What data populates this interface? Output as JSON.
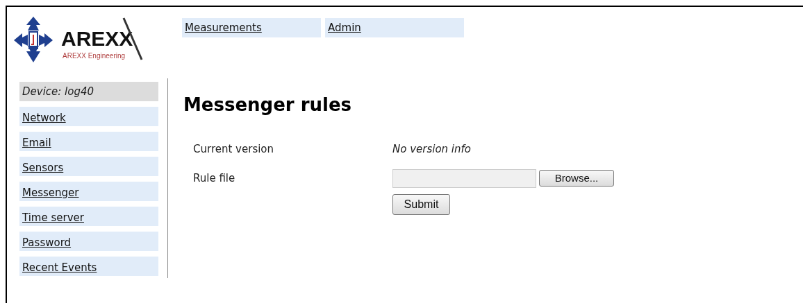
{
  "logo": {
    "wordmark": "AREXX",
    "tagline": "AREXX Engineering"
  },
  "top_nav": [
    "Measurements",
    "Admin"
  ],
  "sidebar": {
    "items": [
      {
        "kind": "heading",
        "label": "Device: log40"
      },
      {
        "kind": "link",
        "label": "Network"
      },
      {
        "kind": "link",
        "label": "Email"
      },
      {
        "kind": "link",
        "label": "Sensors"
      },
      {
        "kind": "link",
        "label": "Messenger"
      },
      {
        "kind": "link",
        "label": "Time server"
      },
      {
        "kind": "link",
        "label": "Password"
      },
      {
        "kind": "link",
        "label": "Recent Events"
      }
    ]
  },
  "content": {
    "title": "Messenger rules",
    "rows": [
      {
        "kind": "info",
        "label": "Current version",
        "value": "No version info"
      },
      {
        "kind": "file",
        "label": "Rule file",
        "button": "Browse..."
      }
    ],
    "submit": "Submit"
  }
}
